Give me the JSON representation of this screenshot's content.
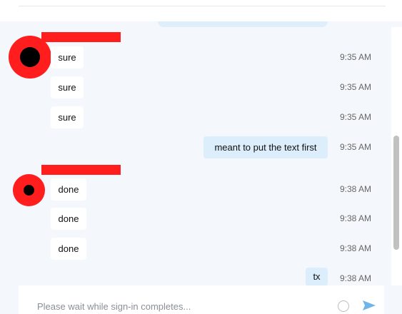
{
  "messages": [
    {
      "text": "sure",
      "time": "9:35 AM",
      "direction": "in"
    },
    {
      "text": "sure",
      "time": "9:35 AM",
      "direction": "in"
    },
    {
      "text": "sure",
      "time": "9:35 AM",
      "direction": "in"
    },
    {
      "text": "meant to put the text first",
      "time": "9:35 AM",
      "direction": "out"
    },
    {
      "text": "done",
      "time": "9:38 AM",
      "direction": "in"
    },
    {
      "text": "done",
      "time": "9:38 AM",
      "direction": "in"
    },
    {
      "text": "done",
      "time": "9:38 AM",
      "direction": "in"
    },
    {
      "text": "tx",
      "time": "9:38 AM",
      "direction": "out"
    }
  ],
  "composer": {
    "placeholder": "Please wait while sign-in completes..."
  },
  "icons": {
    "emoji": "emoji-icon",
    "send": "send-icon"
  },
  "colors": {
    "incoming_bubble": "#ffffff",
    "outgoing_bubble": "#dcedfc",
    "redaction": "#ff1d1d",
    "background": "#f4f8fc",
    "accent": "#6fb5e8"
  }
}
